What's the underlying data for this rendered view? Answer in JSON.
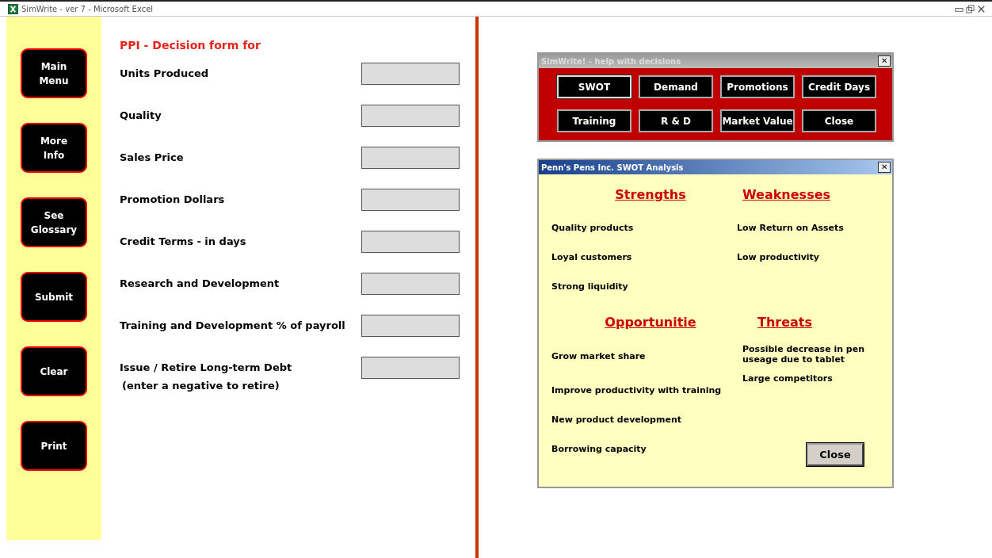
{
  "window": {
    "title": "SimWrite - ver 7 - Microsoft Excel"
  },
  "sidebar": {
    "buttons": [
      "Main\nMenu",
      "More\nInfo",
      "See\nGlossary",
      "Submit",
      "Clear",
      "Print"
    ]
  },
  "form": {
    "title": "PPI - Decision form for",
    "fields": [
      {
        "label": "Units Produced"
      },
      {
        "label": "Quality"
      },
      {
        "label": "Sales Price"
      },
      {
        "label": "Promotion Dollars"
      },
      {
        "label": "Credit Terms - in days"
      },
      {
        "label": "Research and Development"
      },
      {
        "label": "Training and Development % of payroll"
      },
      {
        "label": "Issue / Retire Long-term Debt",
        "note": "(enter a negative to retire)"
      }
    ]
  },
  "help_dialog": {
    "title": "SimWrite! - help with decisions",
    "close_glyph": "✕",
    "buttons": [
      {
        "label": "SWOT",
        "selected": true
      },
      {
        "label": "Demand",
        "selected": false
      },
      {
        "label": "Promotions",
        "selected": false
      },
      {
        "label": "Credit Days",
        "selected": false
      },
      {
        "label": "Training",
        "selected": false
      },
      {
        "label": "R & D",
        "selected": false
      },
      {
        "label": "Market Value",
        "selected": false
      },
      {
        "label": "Close",
        "selected": false
      }
    ]
  },
  "swot_dialog": {
    "title": "Penn's Pens Inc. SWOT Analysis",
    "close_glyph": "✕",
    "quadrants": [
      {
        "heading": "Strengths",
        "items": [
          "Quality products",
          "Loyal customers",
          "Strong liquidity"
        ]
      },
      {
        "heading": "Weaknesses",
        "items": [
          "Low Return on Assets",
          "Low productivity"
        ]
      },
      {
        "heading": "Opportunitie",
        "items": [
          "Grow market share",
          "Improve productivity with training",
          "New product development",
          "Borrowing capacity"
        ]
      },
      {
        "heading": "Threats",
        "items": [
          "Possible decrease in pen useage due to tablet",
          "Large competitors"
        ]
      }
    ],
    "close_button": "Close"
  }
}
